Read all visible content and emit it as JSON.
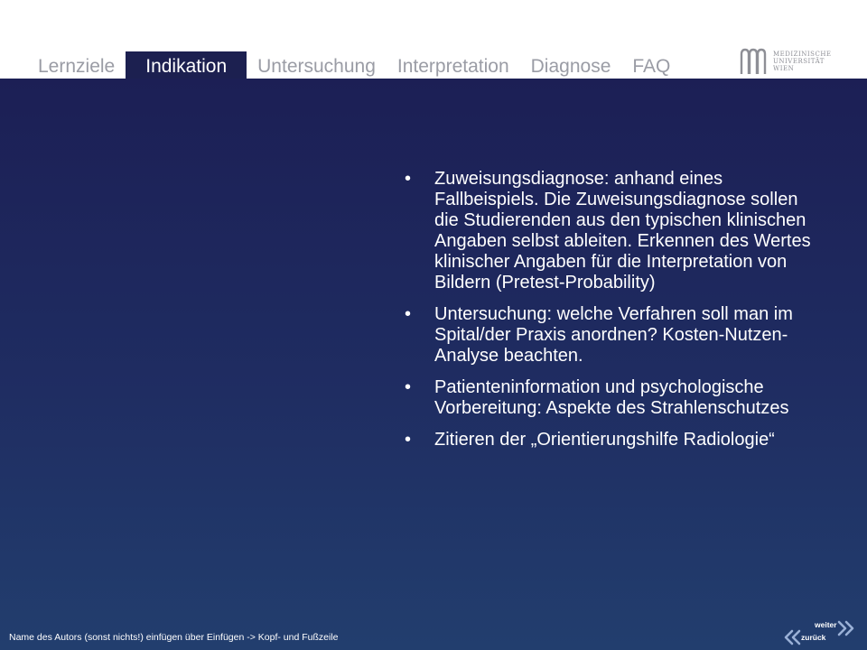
{
  "tabs": [
    {
      "label": "Lernziele",
      "active": false
    },
    {
      "label": "Indikation",
      "active": true
    },
    {
      "label": "Untersuchung",
      "active": false
    },
    {
      "label": "Interpretation",
      "active": false
    },
    {
      "label": "Diagnose",
      "active": false
    },
    {
      "label": "FAQ",
      "active": false
    }
  ],
  "logo": {
    "lines": [
      "MEDIZINISCHE",
      "UNIVERSITÄT",
      "WIEN"
    ],
    "icon": "meduni-wien-logo-icon"
  },
  "content": {
    "bullets": [
      "Zuweisungsdiagnose: anhand eines Fallbeispiels. Die Zuweisungsdiagnose sollen die Studierenden aus den typischen klinischen Angaben selbst ableiten. Erkennen des Wertes klinischer Angaben für die Interpretation von Bildern (Pretest-Probability)",
      "Untersuchung: welche Verfahren soll man im Spital/der Praxis anordnen? Kosten-Nutzen-Analyse beachten.",
      "Patienteninformation und psychologische Vorbereitung: Aspekte des Strahlenschutzes",
      "Zitieren der „Orientierungshilfe Radiologie“"
    ],
    "bullet_glyph": "•"
  },
  "footer": {
    "text": "Name des Autors (sonst nichts!) einfügen über Einfügen -> Kopf- und Fußzeile"
  },
  "nav": {
    "next_label": "weiter",
    "prev_label": "zurück",
    "next_icon": "double-chevron-right-icon",
    "prev_icon": "double-chevron-left-icon"
  },
  "colors": {
    "active_tab_bg": "#1c2050",
    "inactive_tab_text": "#9a9ca5",
    "background_top": "#1c1f55",
    "background_bottom": "#223e6e",
    "text": "#ffffff"
  }
}
